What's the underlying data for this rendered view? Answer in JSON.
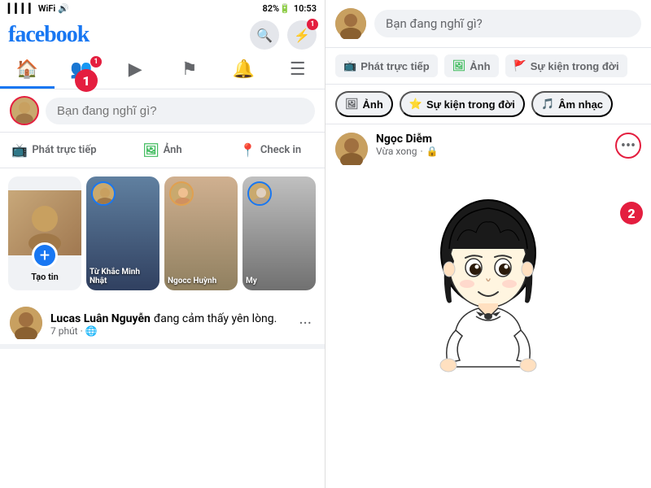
{
  "leftPanel": {
    "statusBar": {
      "signal": "▎▎▎▎",
      "wifi": "▲",
      "battery": "82%🔋",
      "time": "10:53"
    },
    "logo": "facebook",
    "headerIcons": {
      "search": "🔍",
      "messenger": "💬",
      "messengerBadge": "1"
    },
    "navTabs": [
      {
        "id": "home",
        "icon": "🏠",
        "active": true,
        "badge": null
      },
      {
        "id": "friends",
        "icon": "👥",
        "active": false,
        "badge": "1"
      },
      {
        "id": "video",
        "icon": "▶",
        "active": false,
        "badge": null
      },
      {
        "id": "flag",
        "icon": "⚑",
        "active": false,
        "badge": null
      },
      {
        "id": "bell",
        "icon": "🔔",
        "active": false,
        "badge": null
      },
      {
        "id": "menu",
        "icon": "☰",
        "active": false,
        "badge": null
      }
    ],
    "storyInput": {
      "placeholder": "Bạn đang nghĩ gì?"
    },
    "actionRow": [
      {
        "id": "live",
        "icon": "📺",
        "label": "Phát trực tiếp",
        "color": "#e41e3f"
      },
      {
        "id": "photo",
        "icon": "🖼",
        "label": "Ảnh",
        "color": "#45bd62"
      },
      {
        "id": "checkin",
        "icon": "📍",
        "label": "Check in",
        "color": "#f5533d"
      }
    ],
    "stories": [
      {
        "id": "create",
        "label": "Tạo tin",
        "isCreate": true
      },
      {
        "id": "story1",
        "name": "Từ Khắc Minh Nhật",
        "bg": "blue"
      },
      {
        "id": "story2",
        "name": "Ngocc Huỳnh",
        "bg": "warm"
      },
      {
        "id": "story3",
        "name": "My",
        "bg": "grey"
      }
    ],
    "post": {
      "name": "Lucas Luân Nguyễn",
      "action": "đang",
      "feeling": "cảm thấy yên lòng.",
      "time": "7 phút",
      "privacy": "🌐"
    }
  },
  "rightPanel": {
    "header": {
      "placeholder": "Bạn đang nghĩ gì?"
    },
    "actionRow": [
      {
        "id": "live",
        "icon": "📺",
        "label": "Phát trực tiếp",
        "color": "#e41e3f"
      },
      {
        "id": "photo",
        "icon": "🖼",
        "label": "Ảnh",
        "color": "#45bd62"
      },
      {
        "id": "event",
        "icon": "🚩",
        "label": "Sự kiện trong đời",
        "color": "#1877f2"
      }
    ],
    "secondaryRow": [
      {
        "id": "photo",
        "icon": "🖼",
        "label": "Ảnh"
      },
      {
        "id": "life",
        "icon": "⭐",
        "label": "Sự kiện trong đời"
      },
      {
        "id": "music",
        "icon": "🎵",
        "label": "Âm nhạc"
      }
    ],
    "post": {
      "name": "Ngọc Diễm",
      "time": "Vừa xong",
      "privacy": "🔒",
      "moreLabel": "•••"
    }
  },
  "labels": {
    "num1": "1",
    "num2": "2"
  }
}
